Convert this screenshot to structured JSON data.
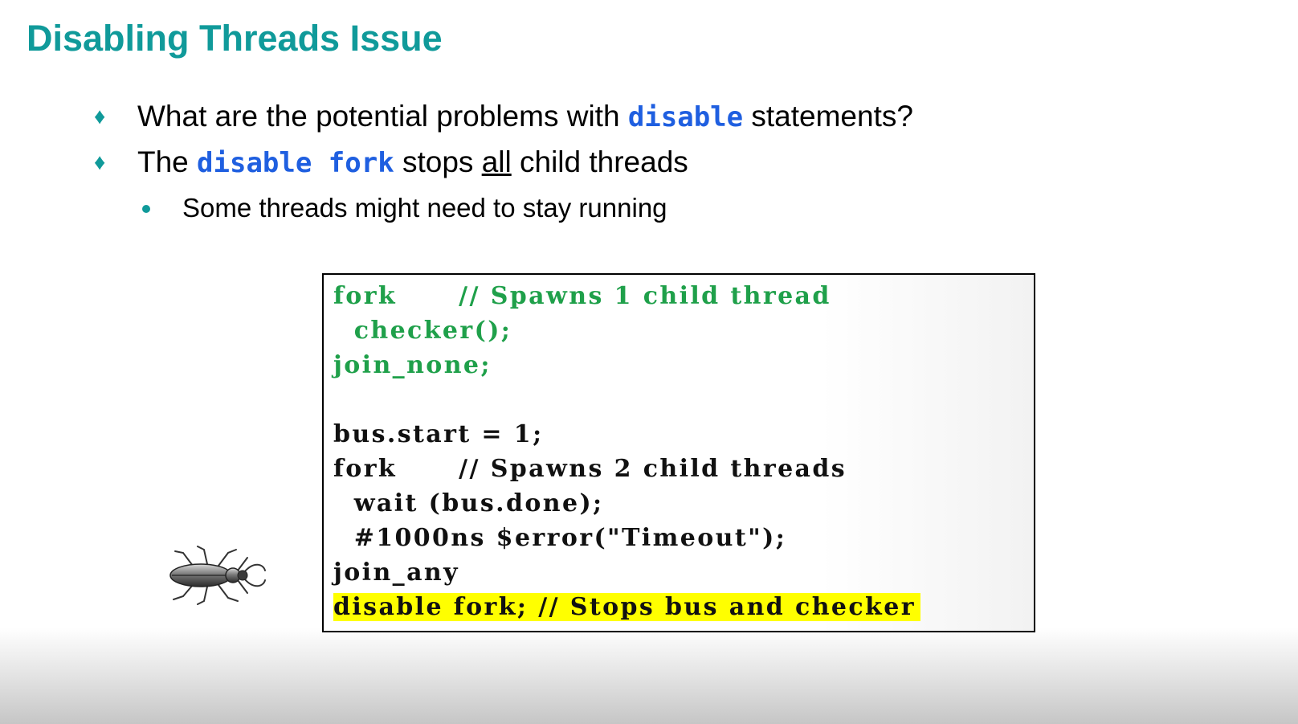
{
  "slide": {
    "title": "Disabling Threads Issue",
    "bullets": [
      {
        "marker": "♦",
        "before": "What are the potential problems with ",
        "keyword": "disable",
        "after": " statements?"
      },
      {
        "marker": "♦",
        "before": "The ",
        "keyword": "disable fork",
        "middle": " stops ",
        "underlined": "all",
        "after": " child threads"
      }
    ],
    "sub_bullets": [
      {
        "text": "Some threads might need to stay running"
      }
    ]
  },
  "code": {
    "lines": [
      {
        "text": "fork      // Spawns 1 child thread",
        "style": "green"
      },
      {
        "text": "  checker();",
        "style": "green"
      },
      {
        "text": "join_none;",
        "style": "green"
      },
      {
        "text": "",
        "style": "plain"
      },
      {
        "text": "bus.start = 1;",
        "style": "plain"
      },
      {
        "text": "fork      // Spawns 2 child threads",
        "style": "plain"
      },
      {
        "text": "  wait (bus.done);",
        "style": "plain"
      },
      {
        "text": "  #1000ns $error(\"Timeout\");",
        "style": "plain"
      },
      {
        "text": "join_any",
        "style": "plain"
      },
      {
        "text": "disable fork; // Stops bus and checker",
        "style": "highlight"
      }
    ]
  },
  "decor": {
    "bug_icon": "stag-beetle-icon",
    "title_color": "#109a9a",
    "keyword_color": "#1f5fe0",
    "code_green": "#1fa04a",
    "highlight_color": "#ffff00"
  }
}
